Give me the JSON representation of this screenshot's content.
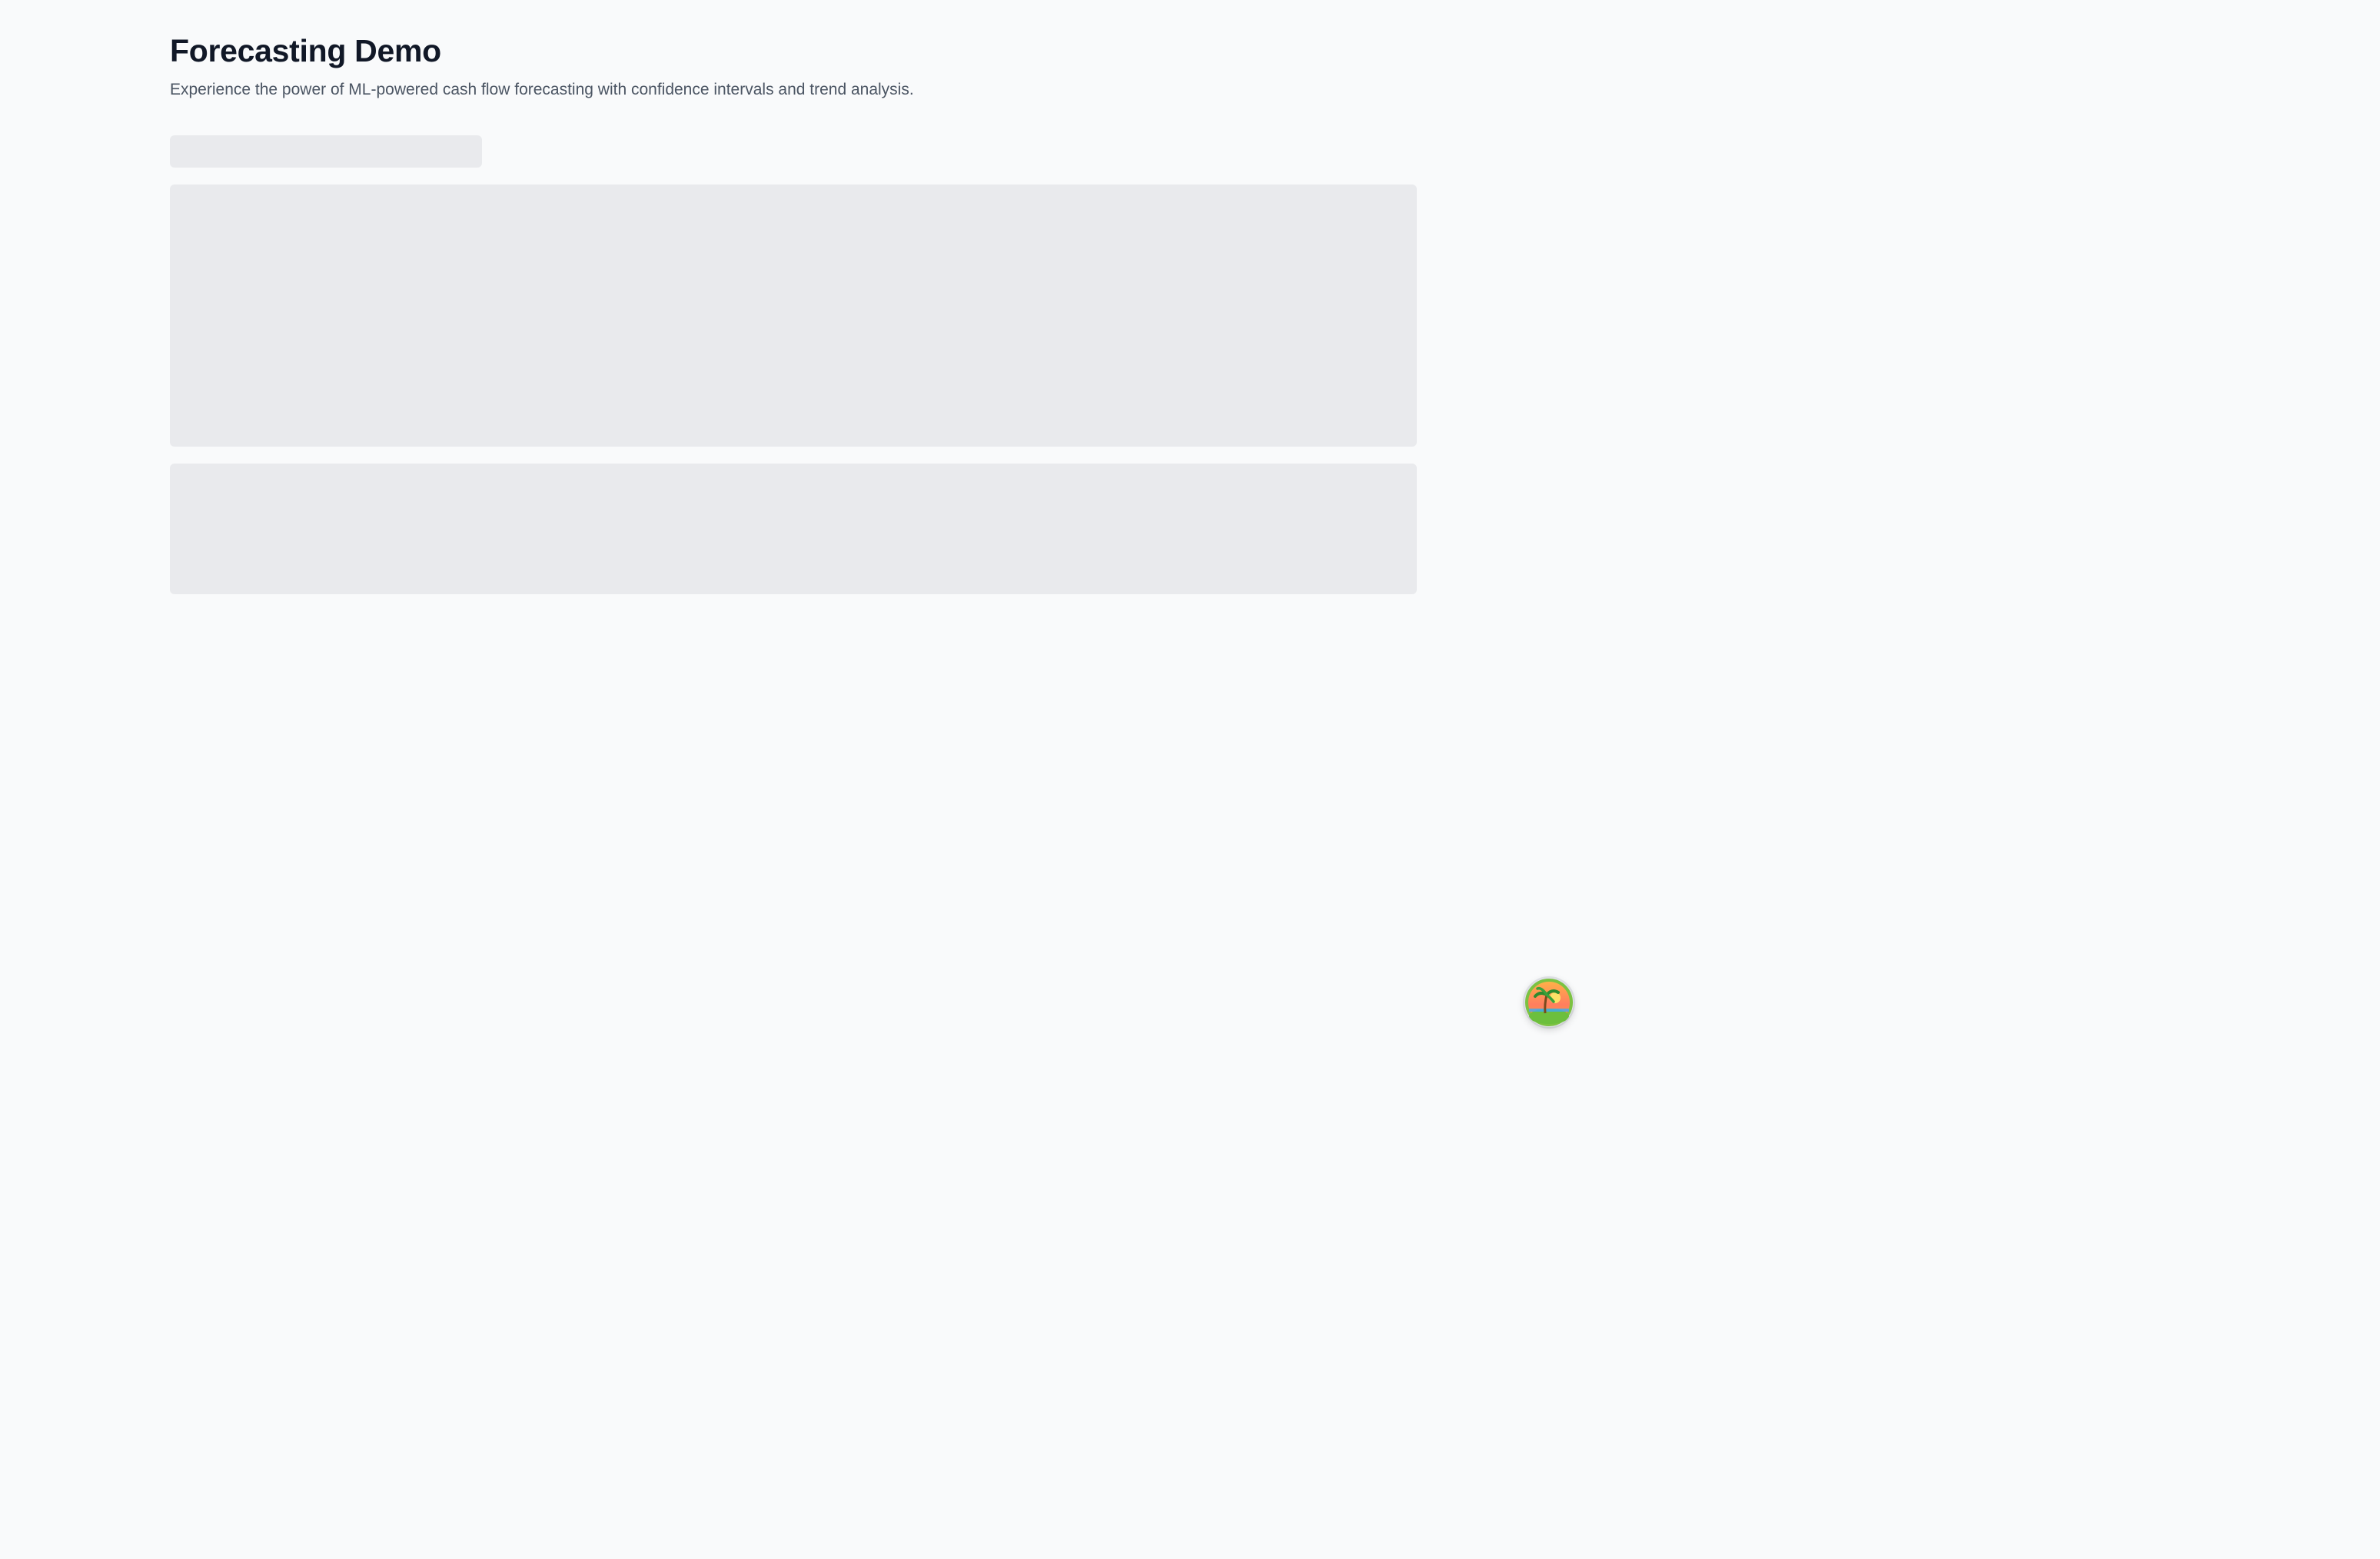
{
  "header": {
    "title": "Forecasting Demo",
    "subtitle": "Experience the power of ML-powered cash flow forecasting with confidence intervals and trend analysis."
  },
  "loading_state": {
    "placeholders": [
      "tabs-skeleton",
      "chart-skeleton",
      "summary-skeleton"
    ]
  },
  "floating_button": {
    "icon": "palm-tree-sunset-icon"
  },
  "colors": {
    "background": "#f9fafb",
    "skeleton": "#e9eaed",
    "title": "#111827",
    "subtitle": "#4b5563"
  }
}
